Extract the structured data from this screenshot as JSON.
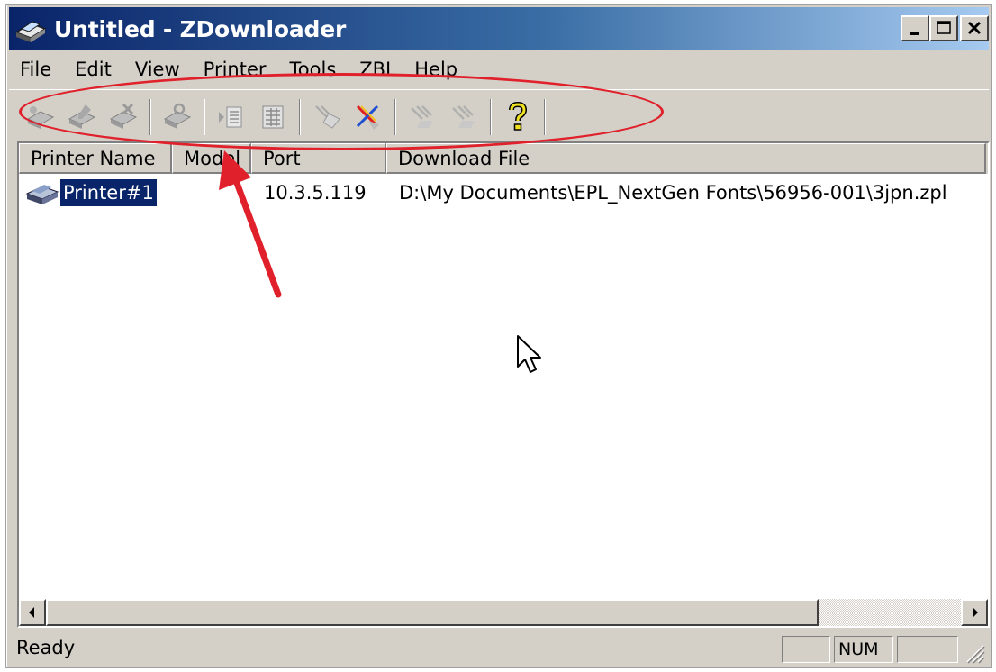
{
  "window": {
    "title": "Untitled - ZDownloader",
    "app_icon": "zdownloader-printer-icon"
  },
  "menu": {
    "items": [
      {
        "label": "File"
      },
      {
        "label": "Edit"
      },
      {
        "label": "View"
      },
      {
        "label": "Printer"
      },
      {
        "label": "Tools"
      },
      {
        "label": "ZBI"
      },
      {
        "label": "Help"
      }
    ]
  },
  "toolbar": {
    "buttons": [
      {
        "icon": "add-printer-icon"
      },
      {
        "icon": "edit-printer-icon"
      },
      {
        "icon": "delete-printer-icon"
      },
      {
        "icon": "printer-settings-icon"
      },
      {
        "icon": "list-icon"
      },
      {
        "icon": "grid-icon"
      },
      {
        "icon": "download-icon"
      },
      {
        "icon": "cancel-download-icon"
      },
      {
        "icon": "epl-download-icon"
      },
      {
        "icon": "zpl-download-icon"
      },
      {
        "icon": "help-icon"
      }
    ]
  },
  "list": {
    "columns": [
      "Printer Name",
      "Model",
      "Port",
      "Download File"
    ],
    "rows": [
      {
        "printer_name": "Printer#1",
        "model": "",
        "port": "10.3.5.119",
        "download_file": "D:\\My Documents\\EPL_NextGen Fonts\\56956-001\\3jpn.zpl"
      }
    ]
  },
  "status": {
    "text": "Ready",
    "pane_1": "",
    "pane_num": "NUM",
    "pane_3": ""
  },
  "colors": {
    "annotation": "#e0202a",
    "selection": "#0a246a",
    "title_gradient_start": "#0a246a",
    "title_gradient_end": "#a6caf0"
  }
}
